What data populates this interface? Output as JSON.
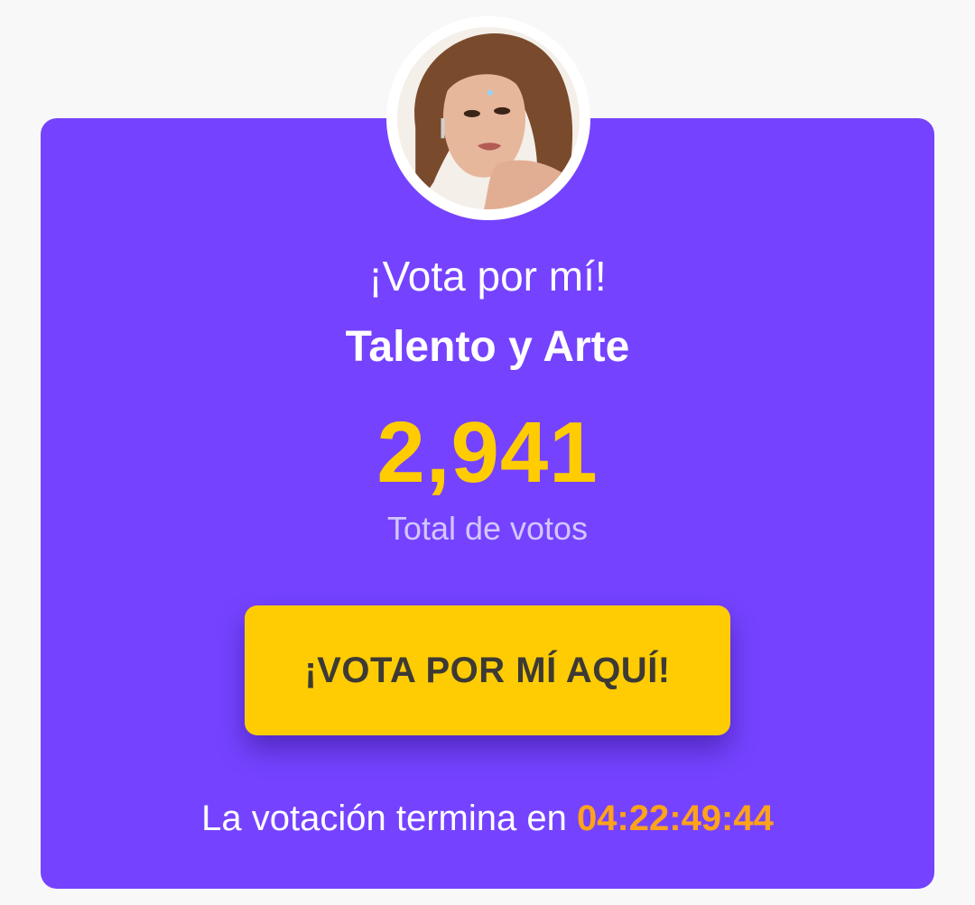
{
  "card": {
    "background_color": "#7543ff",
    "avatar_icon": "profile-photo",
    "subtitle": "¡Vota por mí!",
    "category": "Talento y Arte",
    "votes_count": "2,941",
    "votes_label": "Total de votos",
    "vote_button_label": "¡VOTA POR MÍ AQUÍ!",
    "countdown_prefix": "La votación termina en",
    "countdown_value": "04:22:49:44"
  },
  "colors": {
    "accent_yellow": "#ffcc00",
    "button_yellow": "#ffcc03",
    "timer_orange": "#ffa31a"
  }
}
